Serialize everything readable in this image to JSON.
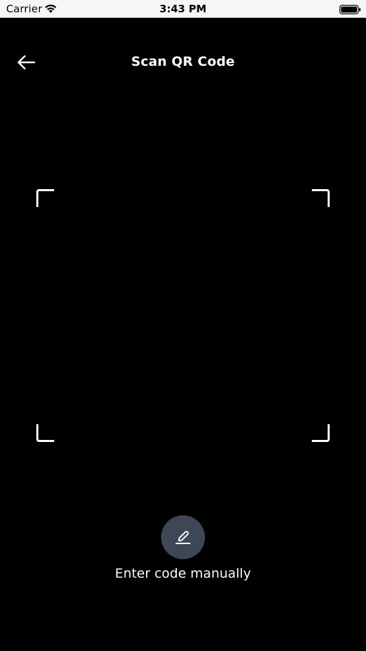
{
  "status_bar": {
    "carrier": "Carrier",
    "time": "3:43 PM",
    "wifi_icon": "wifi-icon",
    "battery_icon": "battery-icon"
  },
  "header": {
    "back_icon": "arrow-left-icon",
    "title": "Scan QR Code"
  },
  "scanner": {
    "frame": "scan-frame"
  },
  "manual_entry": {
    "icon": "edit-pencil-icon",
    "label": "Enter code manually",
    "button_color": "#3f4756"
  },
  "colors": {
    "background": "#000000",
    "foreground": "#ffffff",
    "status_bar": "#f6f6f6"
  }
}
